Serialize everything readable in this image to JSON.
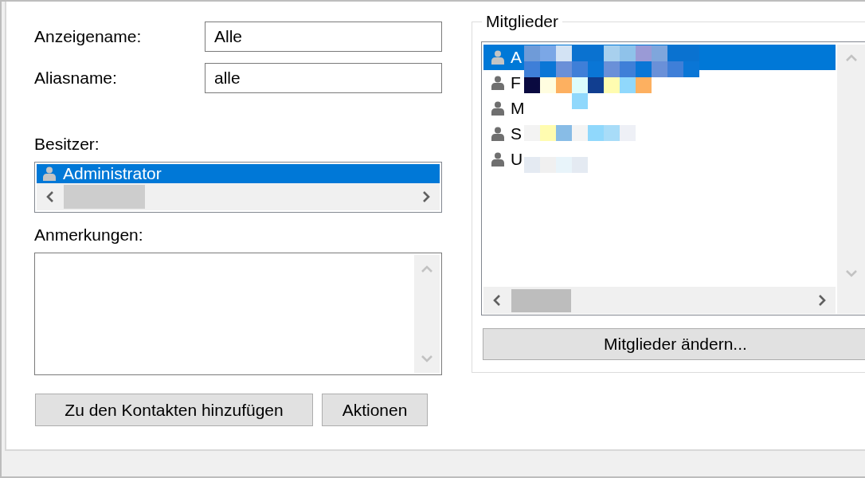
{
  "fields": [
    {
      "label": "Anzeigename:",
      "value": "Alle"
    },
    {
      "label": "Aliasname:",
      "value": "alle"
    }
  ],
  "owner": {
    "label": "Besitzer:",
    "items": [
      {
        "name": "Administrator",
        "selected": true
      }
    ]
  },
  "notes": {
    "label": "Anmerkungen:"
  },
  "buttons": [
    "Zu den Kontakten hinzufügen",
    "Aktionen"
  ],
  "members": {
    "title": "Mitglieder",
    "items": [
      {
        "name": "A",
        "selected": true
      },
      {
        "name": "F",
        "selected": false
      },
      {
        "name": "M",
        "selected": false
      },
      {
        "name": "S",
        "selected": false
      },
      {
        "name": "U",
        "selected": false
      }
    ],
    "button": "Mitglieder ändern..."
  }
}
